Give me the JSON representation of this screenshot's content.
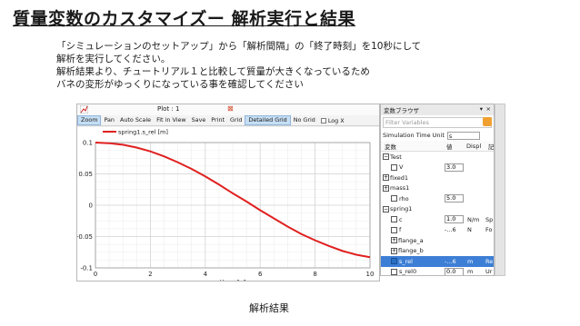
{
  "slide": {
    "title": "質量変数のカスタマイズー 解析実行と結果",
    "lines": [
      "「シミュレーションのセットアップ」から「解析間隔」の「終了時刻」を10秒にして",
      "解析を実行してください。",
      "解析結果より、チュートリアル１と比較して質量が大きくなっているため",
      "バネの変形がゆっくりになっている事を確認してください"
    ],
    "caption": "解析結果"
  },
  "plot_window": {
    "tab_label": "Plot : 1",
    "toolbar": [
      "Zoom",
      "Pan",
      "Auto Scale",
      "Fit in View",
      "Save",
      "Print",
      "Grid",
      "Detailed Grid",
      "No Grid"
    ],
    "active_tools": [
      "Zoom",
      "Detailed Grid"
    ],
    "log_x_label": "Log X",
    "line_color": "#e02020"
  },
  "chart_data": {
    "type": "line",
    "xlabel": "time [s]",
    "ylabel": "",
    "xlim": [
      0,
      10
    ],
    "ylim": [
      -0.1,
      0.1
    ],
    "xticks": [
      "0",
      "2",
      "4",
      "6",
      "8",
      "10"
    ],
    "yticks": [
      "0.1",
      "0.05",
      "0",
      "-0.05",
      "-0.1"
    ],
    "grid": true,
    "legend": "top-left",
    "series": [
      {
        "name": "spring1.s_rel [m]",
        "x": [
          0,
          0.5,
          1,
          1.5,
          2,
          2.5,
          3,
          3.5,
          4,
          4.5,
          5,
          5.5,
          6,
          6.5,
          7,
          7.5,
          8,
          8.5,
          9,
          9.5,
          10
        ],
        "y": [
          0.1,
          0.099,
          0.0965,
          0.092,
          0.086,
          0.078,
          0.0685,
          0.058,
          0.046,
          0.033,
          0.019,
          0.006,
          -0.008,
          -0.021,
          -0.034,
          -0.046,
          -0.056,
          -0.065,
          -0.073,
          -0.079,
          -0.083
        ]
      }
    ]
  },
  "variable_browser": {
    "title": "変数ブラウザ",
    "filter_placeholder": "Filter Variables",
    "time_unit_label": "Simulation Time Unit",
    "time_unit_value": "s",
    "columns": [
      "変数",
      "値",
      "Displ",
      "記"
    ],
    "rows": [
      {
        "indent": 0,
        "exp": "−",
        "check": false,
        "label": "Test",
        "value": "",
        "unit": "",
        "desc": "",
        "sel": false
      },
      {
        "indent": 1,
        "exp": "",
        "check": true,
        "label": "V",
        "value": "3.0",
        "valbox": true,
        "unit": "",
        "desc": "",
        "sel": false
      },
      {
        "indent": 0,
        "exp": "+",
        "check": false,
        "label": "fixed1",
        "value": "",
        "unit": "",
        "desc": "",
        "sel": false
      },
      {
        "indent": 0,
        "exp": "+",
        "check": false,
        "label": "mass1",
        "value": "",
        "unit": "",
        "desc": "",
        "sel": false
      },
      {
        "indent": 1,
        "exp": "",
        "check": true,
        "label": "rho",
        "value": "5.0",
        "valbox": true,
        "unit": "",
        "desc": "",
        "sel": false
      },
      {
        "indent": 0,
        "exp": "−",
        "check": false,
        "label": "spring1",
        "value": "",
        "unit": "",
        "desc": "",
        "sel": false
      },
      {
        "indent": 1,
        "exp": "",
        "check": true,
        "label": "c",
        "value": "1.0",
        "valbox": true,
        "unit": "N/m",
        "desc": "Sp",
        "sel": false
      },
      {
        "indent": 1,
        "exp": "",
        "check": true,
        "label": "f",
        "value": "-...6",
        "valbox": false,
        "unit": "N",
        "desc": "Fo",
        "sel": false
      },
      {
        "indent": 1,
        "exp": "+",
        "check": false,
        "label": "flange_a",
        "value": "",
        "unit": "",
        "desc": "",
        "sel": false
      },
      {
        "indent": 1,
        "exp": "+",
        "check": false,
        "label": "flange_b",
        "value": "",
        "unit": "",
        "desc": "",
        "sel": false
      },
      {
        "indent": 1,
        "exp": "",
        "check": true,
        "checked": true,
        "label": "s_rel",
        "value": "-...6",
        "valbox": false,
        "unit": "m",
        "desc": "Re",
        "sel": true
      },
      {
        "indent": 1,
        "exp": "",
        "check": true,
        "label": "s_rel0",
        "value": "0.0",
        "valbox": true,
        "unit": "m",
        "desc": "Ur",
        "sel": false
      }
    ]
  }
}
